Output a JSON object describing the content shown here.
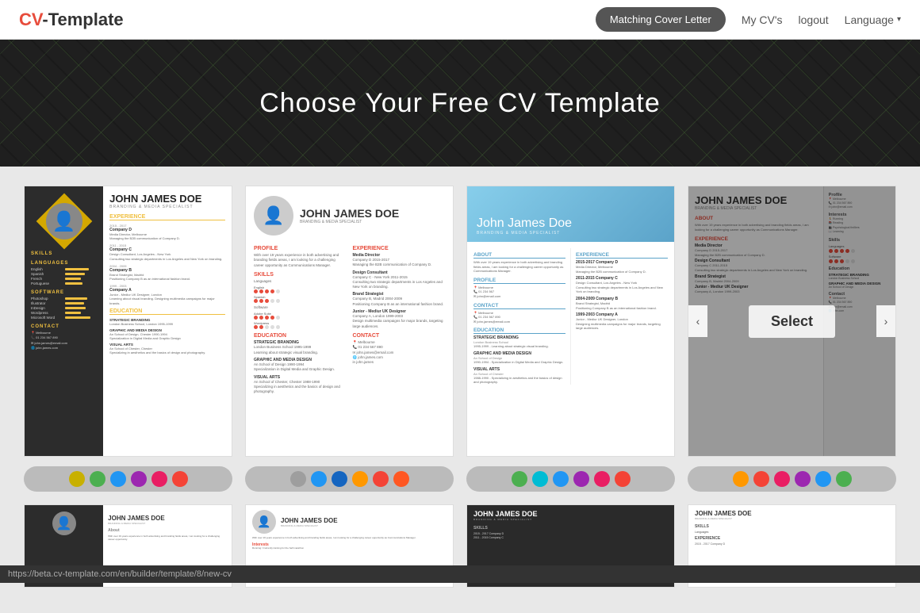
{
  "header": {
    "logo": "CV-Template",
    "logo_cv": "CV",
    "logo_dash": "-",
    "logo_template": "Template",
    "nav": {
      "matching_cover": "Matching Cover Letter",
      "my_cvs": "My CV's",
      "logout": "logout",
      "language": "Language"
    }
  },
  "hero": {
    "title": "Choose Your Free CV Template"
  },
  "templates": {
    "select_label": "Select",
    "row1": [
      {
        "id": "t1",
        "name": "JOHN JAMES DOE",
        "subtitle": "BRANDING & MEDIA SPECIALIST",
        "style": "dark-left"
      },
      {
        "id": "t2",
        "name": "JOHN JAMES DOE",
        "subtitle": "BRANDING & MEDIA SPECIALIST",
        "style": "white-photo"
      },
      {
        "id": "t3",
        "name": "John James Doe",
        "subtitle": "Branding & media specialist",
        "style": "blue-header"
      },
      {
        "id": "t4",
        "name": "JOHN JAMES DOE",
        "subtitle": "BRANDING & MEDIA SPECIALIST",
        "style": "right-panel",
        "selected": true
      }
    ]
  },
  "color_groups": [
    {
      "id": "cg1",
      "colors": [
        "#c8b000",
        "#4caf50",
        "#2196f3",
        "#9c27b0",
        "#e91e63",
        "#f44336"
      ]
    },
    {
      "id": "cg2",
      "colors": [
        "#9e9e9e",
        "#2196f3",
        "#1565c0",
        "#ff9800",
        "#f44336",
        "#ff5722"
      ]
    },
    {
      "id": "cg3",
      "colors": [
        "#4caf50",
        "#00bcd4",
        "#2196f3",
        "#9c27b0",
        "#e91e63",
        "#f44336"
      ]
    },
    {
      "id": "cg4",
      "colors": [
        "#ff9800",
        "#f44336",
        "#e91e63",
        "#9c27b0",
        "#2196f3",
        "#4caf50"
      ]
    }
  ],
  "bottom_templates": [
    {
      "id": "bt1",
      "name": "JOHN JAMES DOE",
      "subtitle": "BRANDING & MEDIA SPECIALIST",
      "style": "dark-left-2"
    },
    {
      "id": "bt2",
      "name": "JOHN JAMES DOE",
      "subtitle": "BRANDING & MEDIA SPECIALIST",
      "style": "white-photo-2"
    },
    {
      "id": "bt3",
      "name": "JOHN JAMES DOE",
      "subtitle": "BRANDING & MEDIA SPECIALIST",
      "style": "dark-full"
    },
    {
      "id": "bt4",
      "name": "JOHN JAMES DOE",
      "subtitle": "BRANDING & MEDIA SPECIALIST",
      "style": "minimal"
    }
  ],
  "status_bar": {
    "url": "https://beta.cv-template.com/en/builder/template/8/new-cv"
  }
}
